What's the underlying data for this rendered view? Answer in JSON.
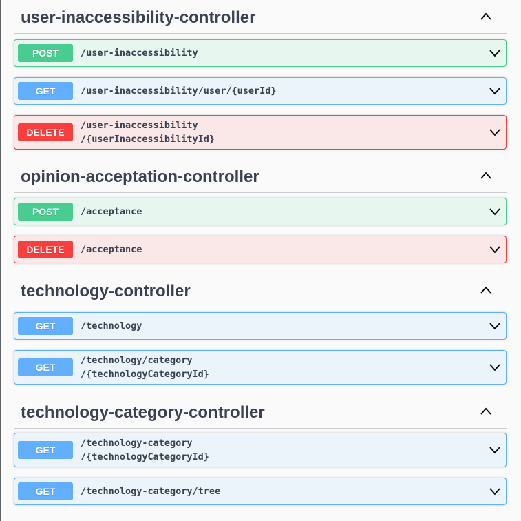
{
  "sections": [
    {
      "title": "user-inaccessibility-controller",
      "operations": [
        {
          "method": "POST",
          "path_line1": "/user-inaccessibility",
          "path_line2": ""
        },
        {
          "method": "GET",
          "path_line1": "/user-inaccessibility/user/{userId}",
          "path_line2": ""
        },
        {
          "method": "DELETE",
          "path_line1": "/user-inaccessibility",
          "path_line2": "/{userInaccessibilityId}"
        }
      ]
    },
    {
      "title": "opinion-acceptation-controller",
      "operations": [
        {
          "method": "POST",
          "path_line1": "/acceptance",
          "path_line2": ""
        },
        {
          "method": "DELETE",
          "path_line1": "/acceptance",
          "path_line2": ""
        }
      ]
    },
    {
      "title": "technology-controller",
      "operations": [
        {
          "method": "GET",
          "path_line1": "/technology",
          "path_line2": ""
        },
        {
          "method": "GET",
          "path_line1": "/technology/category",
          "path_line2": "/{technologyCategoryId}"
        }
      ]
    },
    {
      "title": "technology-category-controller",
      "operations": [
        {
          "method": "GET",
          "path_line1": "/technology-category",
          "path_line2": "/{technologyCategoryId}"
        },
        {
          "method": "GET",
          "path_line1": "/technology-category/tree",
          "path_line2": ""
        }
      ]
    }
  ],
  "icons": {
    "collapse": "chevron-up-icon",
    "expand": "chevron-down-icon"
  },
  "colors": {
    "post": "#49cc90",
    "get": "#61affe",
    "delete": "#f93e3e",
    "text": "#3b4151"
  }
}
